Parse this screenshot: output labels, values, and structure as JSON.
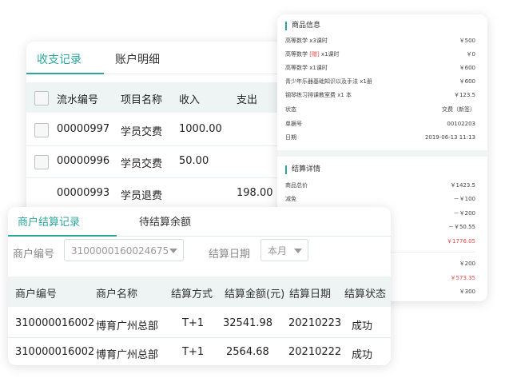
{
  "ledger": {
    "tabs": [
      {
        "label": "收支记录"
      },
      {
        "label": "账户明细"
      }
    ],
    "columns": {
      "serial": "流水编号",
      "item": "项目名称",
      "income": "收入",
      "expense": "支出"
    },
    "rows": [
      {
        "serial": "00000997",
        "item": "学员交费",
        "income": "1000.00",
        "expense": ""
      },
      {
        "serial": "00000996",
        "item": "学员交费",
        "income": "50.00",
        "expense": ""
      },
      {
        "serial": "00000993",
        "item": "学员退费",
        "income": "",
        "expense": "198.00"
      }
    ]
  },
  "product": {
    "title": "商品信息",
    "items": [
      {
        "name": "高等数学 x3课时",
        "tag": "",
        "suffix": "",
        "price": "￥500"
      },
      {
        "name": "高等数学 ",
        "tag": "[赠]",
        "suffix": " x1课时",
        "price": "￥0"
      },
      {
        "name": "高等数学 x1课时",
        "tag": "",
        "suffix": "",
        "price": "￥600"
      },
      {
        "name": "青少年乐器基础知识以及手法 x1册",
        "tag": "",
        "suffix": "",
        "price": "￥600"
      },
      {
        "name": "钢琴练习排课教室费 x1 本",
        "tag": "",
        "suffix": "",
        "price": "￥123.5"
      },
      {
        "name": "状态",
        "tag": "",
        "suffix": "",
        "price": "交费（新签）"
      },
      {
        "name": "单据号",
        "tag": "",
        "suffix": "",
        "price": "00102203"
      },
      {
        "name": "日期",
        "tag": "",
        "suffix": "",
        "price": "2019-06-13 11:13"
      }
    ],
    "settle_title": "结算详情",
    "settle": [
      {
        "name": "商品总价",
        "value": "￥1423.5",
        "red": false
      },
      {
        "name": "减免",
        "value": "－￥100",
        "red": false
      },
      {
        "name": "",
        "value": "－￥200",
        "red": false
      },
      {
        "name": "",
        "value": "－￥50.55",
        "red": false
      },
      {
        "name": "",
        "value": "￥1776.05",
        "red": true
      }
    ],
    "extra": [
      {
        "value": "￥200",
        "red": false
      },
      {
        "value": "￥573.35",
        "red": true
      },
      {
        "value": "￥300",
        "red": false
      }
    ]
  },
  "merchant": {
    "tabs": [
      {
        "label": "商户结算记录"
      },
      {
        "label": "待结算余额"
      }
    ],
    "filters": {
      "merchant_no_label": "商户编号",
      "merchant_no_value": "3100000160024675",
      "date_label": "结算日期",
      "date_value": "本月"
    },
    "columns": {
      "no": "商户编号",
      "name": "商户名称",
      "method": "结算方式",
      "amount": "结算金额(元)",
      "date": "结算日期",
      "status": "结算状态"
    },
    "rows": [
      {
        "no": "310000016002",
        "name": "博育广州总部",
        "method": "T+1",
        "amount": "32541.98",
        "date": "20210223",
        "status": "成功"
      },
      {
        "no": "310000016002",
        "name": "博育广州总部",
        "method": "T+1",
        "amount": "2564.68",
        "date": "20210222",
        "status": "成功"
      }
    ]
  },
  "colors": {
    "accent": "#2aa79a",
    "header_bg": "#eef4f4",
    "red": "#e84a4a"
  }
}
